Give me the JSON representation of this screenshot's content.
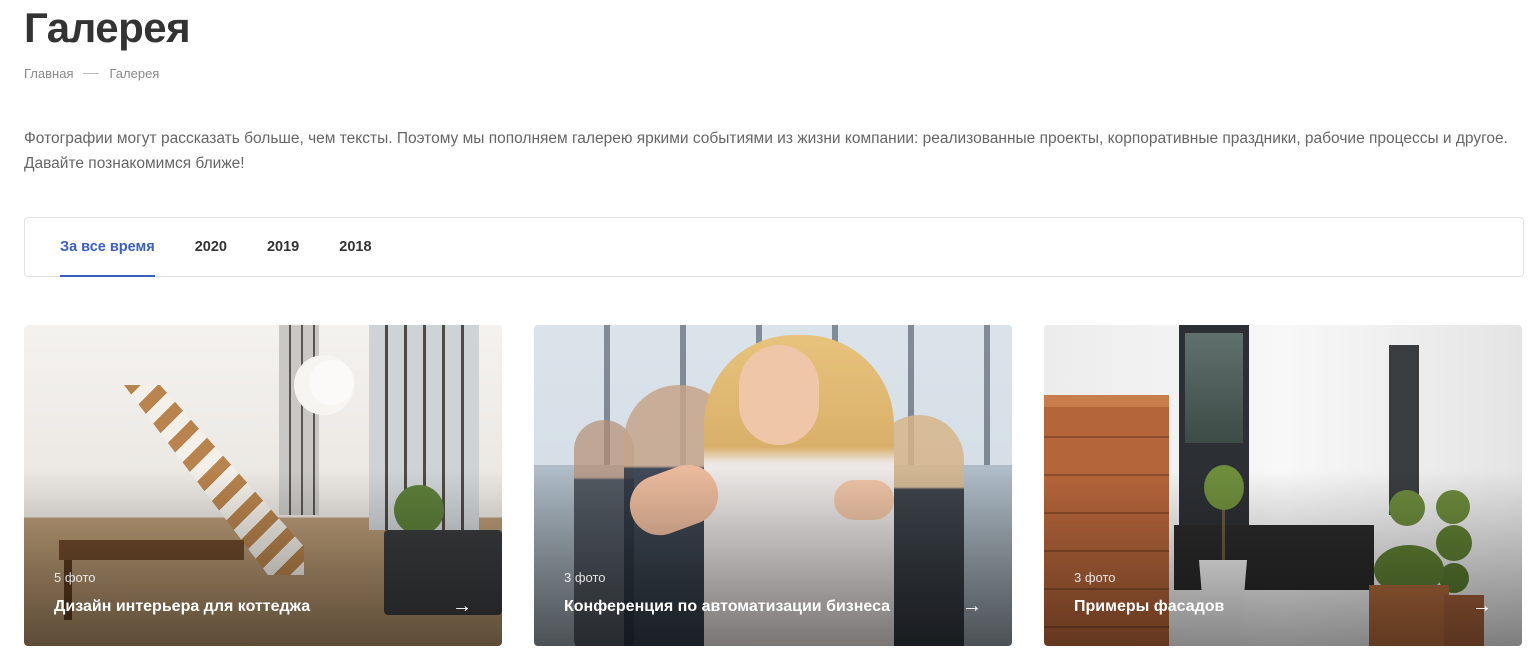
{
  "page": {
    "title": "Галерея",
    "breadcrumb": [
      {
        "label": "Главная"
      },
      {
        "label": "Галерея"
      }
    ],
    "intro": "Фотографии могут рассказать больше, чем тексты. Поэтому мы пополняем галерею яркими событиями из жизни компании: реализованные проекты, корпоративные праздники, рабочие процессы и другое. Давайте познакомимся ближе!"
  },
  "tabs": [
    {
      "label": "За все время",
      "active": true
    },
    {
      "label": "2020",
      "active": false
    },
    {
      "label": "2019",
      "active": false
    },
    {
      "label": "2018",
      "active": false
    }
  ],
  "accent_color": "#3a5fbf",
  "gallery": [
    {
      "count": "5 фото",
      "title": "Дизайн интерьера для коттеджа",
      "arrow": "→",
      "image": "interior-photo"
    },
    {
      "count": "3 фото",
      "title": "Конференция по автоматизации бизнеса",
      "arrow": "→",
      "image": "conference-photo"
    },
    {
      "count": "3 фото",
      "title": "Примеры фасадов",
      "arrow": "→",
      "image": "facade-photo"
    }
  ]
}
